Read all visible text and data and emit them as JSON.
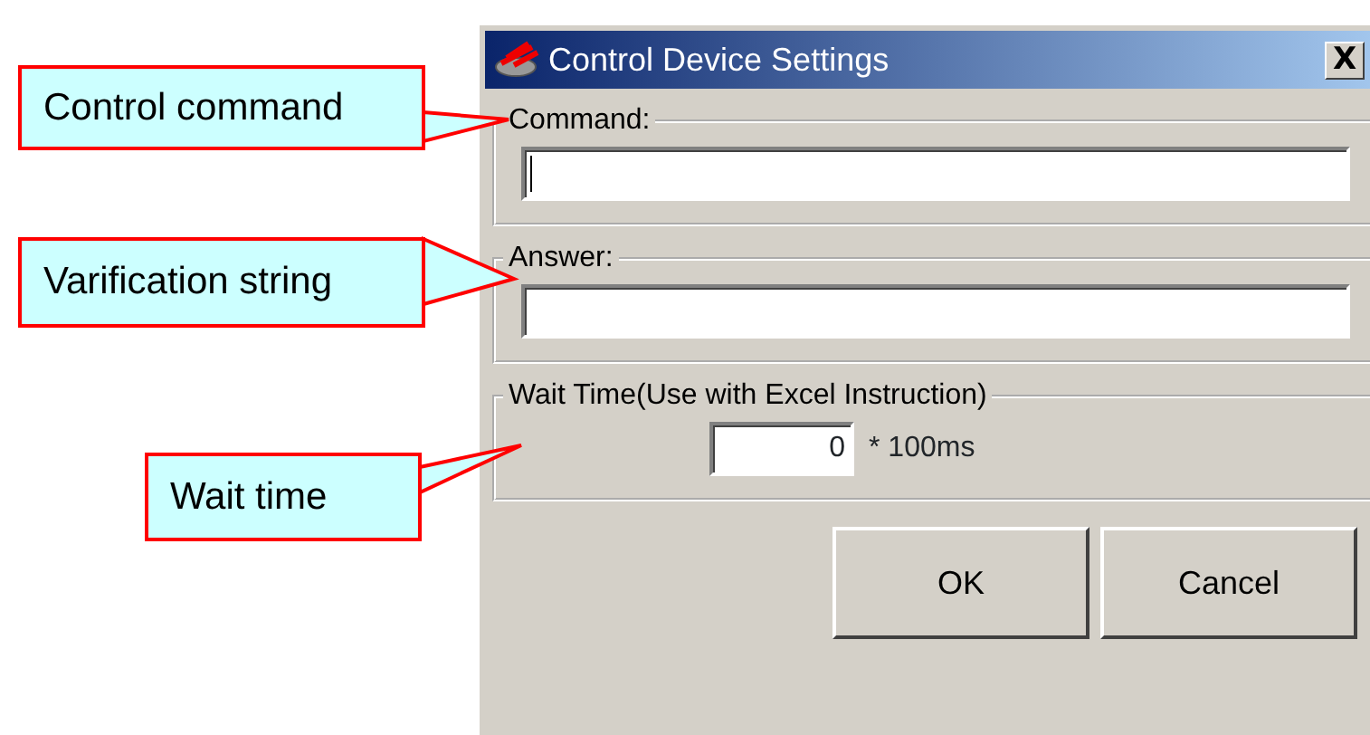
{
  "callouts": [
    {
      "text": "Control command"
    },
    {
      "text": "Varification string"
    },
    {
      "text": "Wait time"
    }
  ],
  "window": {
    "title": "Control Device Settings",
    "close": "X"
  },
  "groups": [
    {
      "kind": "text",
      "label": "Command:",
      "focused": true
    },
    {
      "kind": "text",
      "label": "Answer:",
      "focused": false
    },
    {
      "kind": "number",
      "label": "Wait Time(Use with Excel Instruction)",
      "value": "0",
      "unit": "* 100ms",
      "focused": false
    }
  ],
  "buttons": [
    "OK",
    "Cancel"
  ]
}
